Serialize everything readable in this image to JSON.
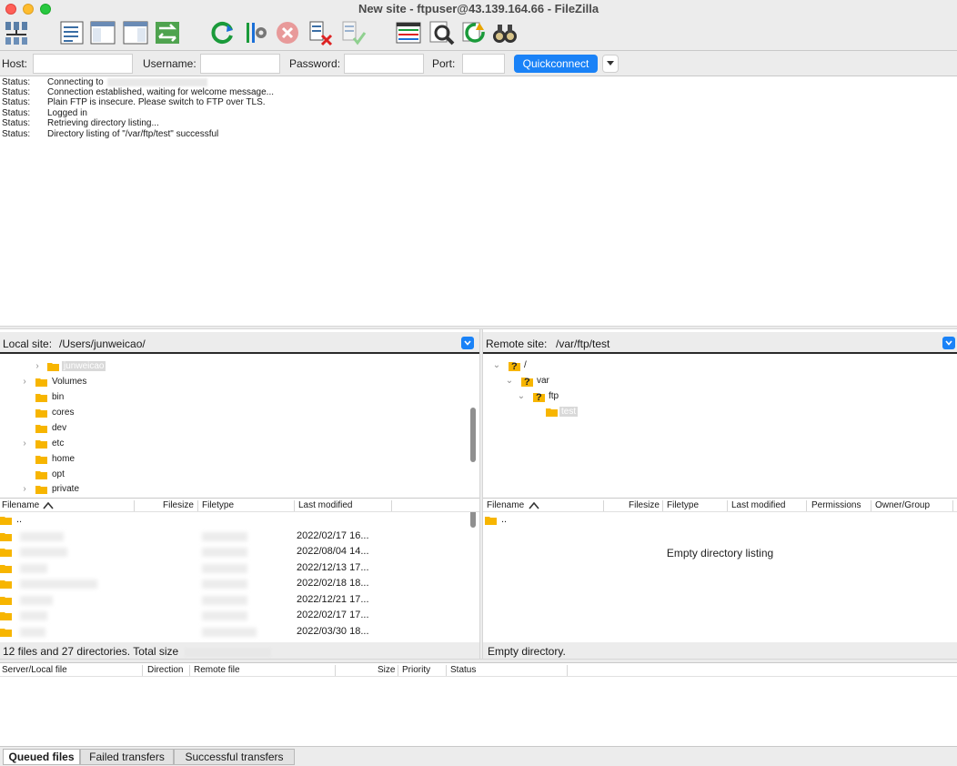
{
  "window": {
    "title": "New site - ftpuser@43.139.164.66 - FileZilla"
  },
  "toolbar": {
    "buttons": [
      {
        "name": "site-manager-icon"
      },
      {
        "name": "toggle-message-log-icon"
      },
      {
        "name": "toggle-local-tree-icon"
      },
      {
        "name": "toggle-remote-tree-icon"
      },
      {
        "name": "toggle-transfer-queue-icon"
      },
      {
        "name": "refresh-icon"
      },
      {
        "name": "process-queue-icon"
      },
      {
        "name": "cancel-operation-icon"
      },
      {
        "name": "disconnect-icon"
      },
      {
        "name": "reconnect-icon"
      },
      {
        "name": "directory-filters-icon"
      },
      {
        "name": "directory-comparison-icon"
      },
      {
        "name": "synchronized-browsing-icon"
      },
      {
        "name": "search-remote-files-icon"
      }
    ]
  },
  "quickconnect": {
    "host_label": "Host:",
    "host_value": "",
    "username_label": "Username:",
    "username_value": "",
    "password_label": "Password:",
    "password_value": "",
    "port_label": "Port:",
    "port_value": "",
    "button_label": "Quickconnect"
  },
  "log": [
    {
      "label": "Status:",
      "text": "Connecting to",
      "redacted": true
    },
    {
      "label": "Status:",
      "text": "Connection established, waiting for welcome message..."
    },
    {
      "label": "Status:",
      "text": "Plain FTP is insecure. Please switch to FTP over TLS."
    },
    {
      "label": "Status:",
      "text": "Logged in"
    },
    {
      "label": "Status:",
      "text": "Retrieving directory listing..."
    },
    {
      "label": "Status:",
      "text": "Directory listing of \"/var/ftp/test\" successful"
    }
  ],
  "local": {
    "site_label": "Local site:",
    "path": "/Users/junweicao/",
    "tree": [
      {
        "label": "junweicao",
        "selected": true,
        "expander": true
      },
      {
        "label": "Volumes",
        "expander": true
      },
      {
        "label": "bin"
      },
      {
        "label": "cores"
      },
      {
        "label": "dev"
      },
      {
        "label": "etc",
        "expander": true
      },
      {
        "label": "home"
      },
      {
        "label": "opt"
      },
      {
        "label": "private",
        "expander": true
      }
    ],
    "columns": {
      "filename": "Filename",
      "filesize": "Filesize",
      "filetype": "Filetype",
      "modified": "Last modified"
    },
    "files": [
      {
        "name": "..",
        "modified": ""
      },
      {
        "name": "",
        "modified": "2022/02/17 16..."
      },
      {
        "name": "",
        "modified": "2022/08/04 14..."
      },
      {
        "name": "",
        "modified": "2022/12/13 17..."
      },
      {
        "name": "",
        "modified": "2022/02/18 18..."
      },
      {
        "name": "",
        "modified": "2022/12/21 17..."
      },
      {
        "name": "",
        "modified": "2022/02/17 17..."
      },
      {
        "name": "",
        "modified": "2022/03/30 18..."
      }
    ],
    "status": "12 files and 27 directories. Total size"
  },
  "remote": {
    "site_label": "Remote site:",
    "path": "/var/ftp/test",
    "tree": [
      {
        "label": "/",
        "expanded": true,
        "unknown": true
      },
      {
        "label": "var",
        "expanded": true,
        "unknown": true
      },
      {
        "label": "ftp",
        "expanded": true,
        "unknown": true
      },
      {
        "label": "test",
        "selected": true
      }
    ],
    "columns": {
      "filename": "Filename",
      "filesize": "Filesize",
      "filetype": "Filetype",
      "modified": "Last modified",
      "permissions": "Permissions",
      "owner": "Owner/Group"
    },
    "files": [
      {
        "name": ".."
      }
    ],
    "empty_message": "Empty directory listing",
    "status": "Empty directory."
  },
  "queue": {
    "columns": {
      "server": "Server/Local file",
      "direction": "Direction",
      "remote": "Remote file",
      "size": "Size",
      "priority": "Priority",
      "status": "Status"
    },
    "tabs": [
      {
        "label": "Queued files",
        "active": true
      },
      {
        "label": "Failed transfers"
      },
      {
        "label": "Successful transfers"
      }
    ]
  },
  "colors": {
    "accent": "#1a82f7",
    "folder": "#f7b500"
  }
}
